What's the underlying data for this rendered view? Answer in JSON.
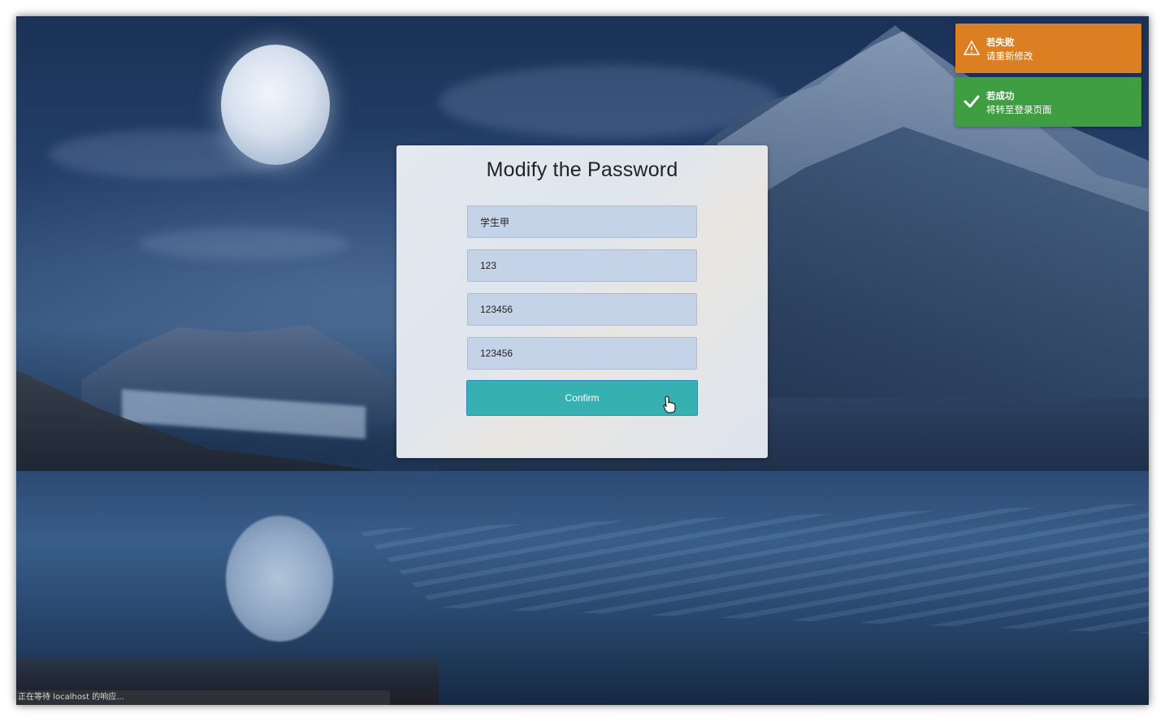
{
  "form": {
    "title": "Modify the Password",
    "username_value": "学生甲",
    "old_password_value": "123",
    "new_password_value": "123456",
    "confirm_password_value": "123456",
    "confirm_label": "Confirm"
  },
  "notifications": [
    {
      "type": "warning",
      "icon": "warning-triangle-icon",
      "title": "若失败",
      "message": "请重新修改",
      "color": "#db7f22"
    },
    {
      "type": "success",
      "icon": "checkmark-icon",
      "title": "若成功",
      "message": "将转至登录页面",
      "color": "#3f9e41"
    }
  ],
  "status_bar": {
    "text": "正在等待 localhost 的响应..."
  },
  "colors": {
    "accent_button": "#36b0b0",
    "input_bg": "#c5d3e9"
  }
}
